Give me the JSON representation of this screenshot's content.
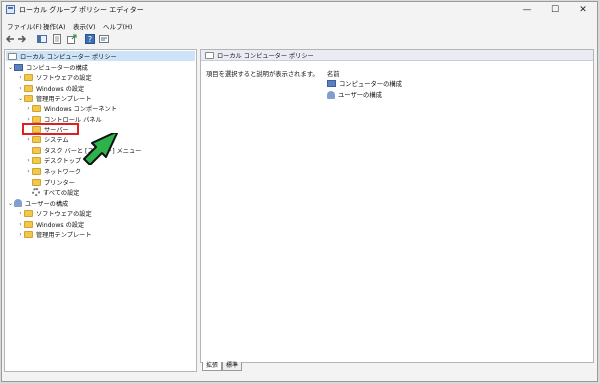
{
  "window": {
    "title": "ローカル グループ ポリシー エディター"
  },
  "window_controls": {
    "minimize": "—",
    "maximize": "☐",
    "close": "✕"
  },
  "menu": [
    "ファイル(F)",
    "操作(A)",
    "表示(V)",
    "ヘルプ(H)"
  ],
  "tree": {
    "header": "ローカル コンピューター ポリシー",
    "rows": [
      {
        "label": "コンピューターの構成",
        "chev": "⌄",
        "icon": "computer-config-icon"
      },
      {
        "label": "ソフトウェアの設定",
        "chev": "›",
        "icon": "folder-icon"
      },
      {
        "label": "Windows の設定",
        "chev": "›",
        "icon": "folder-icon"
      },
      {
        "label": "管理用テンプレート",
        "chev": "⌄",
        "icon": "folder-icon"
      },
      {
        "label": "Windows コンポーネント",
        "chev": "›",
        "icon": "folder-icon"
      },
      {
        "label": "コントロール パネル",
        "chev": "›",
        "icon": "folder-icon"
      },
      {
        "label": "サーバー",
        "chev": "",
        "icon": "folder-icon"
      },
      {
        "label": "システム",
        "chev": "›",
        "icon": "folder-icon"
      },
      {
        "label": "タスク バーと [スタート] メニュー",
        "chev": "",
        "icon": "folder-icon"
      },
      {
        "label": "デスクトップ",
        "chev": "›",
        "icon": "folder-icon"
      },
      {
        "label": "ネットワーク",
        "chev": "›",
        "icon": "folder-icon"
      },
      {
        "label": "プリンター",
        "chev": "",
        "icon": "folder-icon"
      },
      {
        "label": "すべての設定",
        "chev": "",
        "icon": "settings-icon"
      },
      {
        "label": "ユーザーの構成",
        "chev": "⌄",
        "icon": "user-config-icon"
      },
      {
        "label": "ソフトウェアの設定",
        "chev": "›",
        "icon": "folder-icon"
      },
      {
        "label": "Windows の設定",
        "chev": "›",
        "icon": "folder-icon"
      },
      {
        "label": "管理用テンプレート",
        "chev": "›",
        "icon": "folder-icon"
      }
    ]
  },
  "right": {
    "header": "ローカル コンピューター ポリシー",
    "description": "項目を選択すると説明が表示されます。",
    "column_name": "名前",
    "items": [
      "コンピューターの構成",
      "ユーザーの構成"
    ]
  },
  "tabs": [
    "拡張",
    "標準"
  ],
  "colors": {
    "highlight": "#e02020",
    "arrow": "#2db34a",
    "selection": "#cde3f7"
  }
}
